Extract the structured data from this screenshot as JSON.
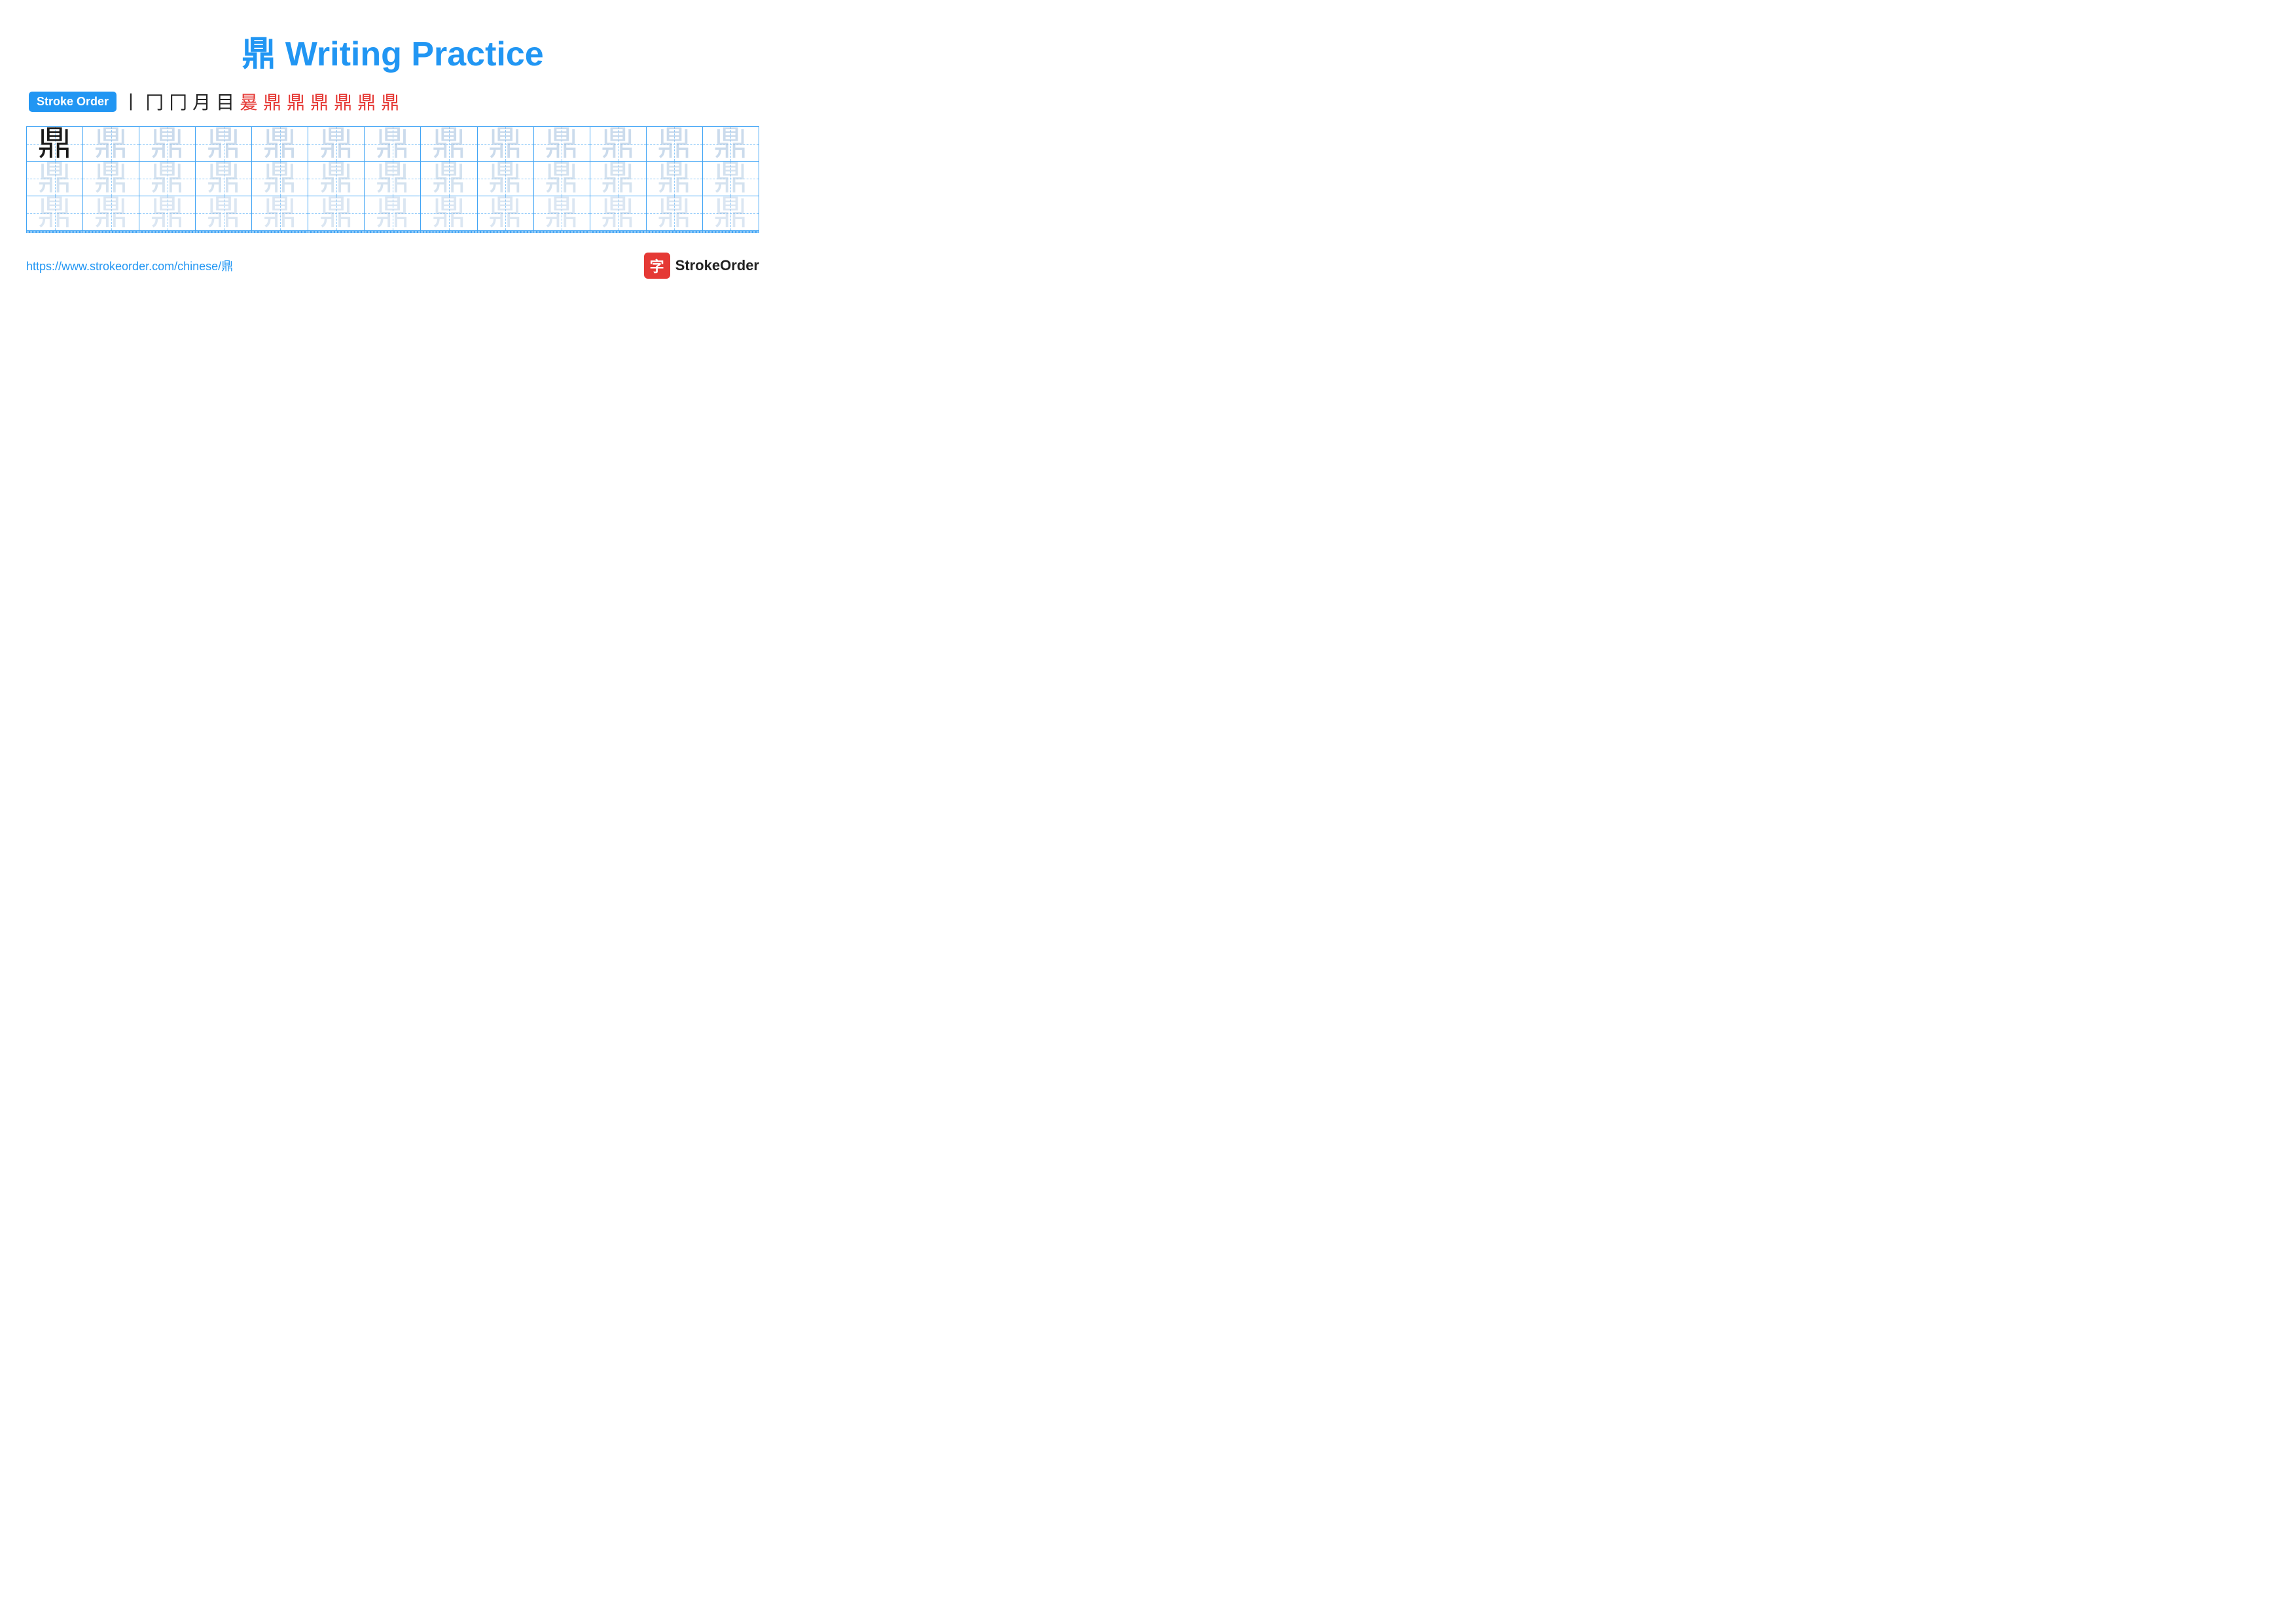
{
  "title": "鼎 Writing Practice",
  "stroke_order": {
    "badge_label": "Stroke Order",
    "strokes": [
      "丨",
      "冂",
      "冂",
      "目",
      "目",
      "鼎_6",
      "鼎_7",
      "鼎_8",
      "鼎_9",
      "鼎_10",
      "鼎_11",
      "鼎"
    ]
  },
  "character": "鼎",
  "rows": 6,
  "cols": 13,
  "footer": {
    "url": "https://www.strokeorder.com/chinese/鼎",
    "logo_icon": "字",
    "logo_text": "StrokeOrder"
  }
}
